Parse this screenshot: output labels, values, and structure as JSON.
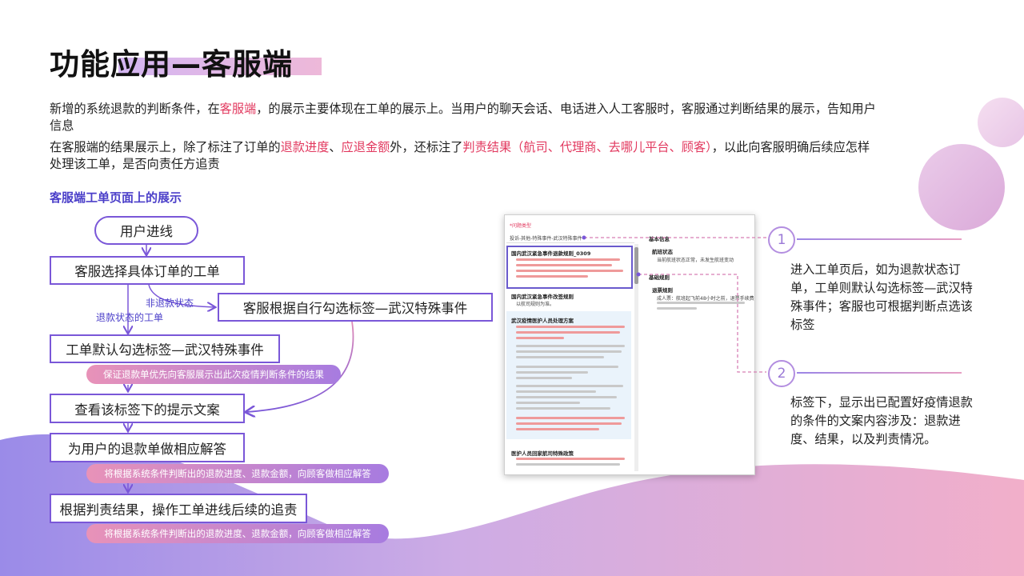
{
  "title": "功能应用—客服端",
  "intro": {
    "line1_a": "新增的系统退款的判断条件，在",
    "line1_hl": "客服端",
    "line1_b": "，的展示主要体现在工单的展示上。当用户的聊天会话、电话进入人工客服时，客服通过判断结果的展示，告知用户",
    "line1_c": "信息",
    "line2_a": "在客服端的结果展示上，除了标注了订单的",
    "line2_hl1": "退款进度",
    "line2_sep": "、",
    "line2_hl2": "应退金额",
    "line2_b": "外，还标注了",
    "line2_hl3": "判责结果（航司、代理商、去哪儿平台、顾客）",
    "line2_c": "，以此向客服明确后续应怎样",
    "line2_d": "处理该工单，是否向责任方追责"
  },
  "subtitle": "客服端工单页面上的展示",
  "flow": {
    "start": "用户进线",
    "step1": "客服选择具体订单的工单",
    "branch_label_refund": "退款状态的工单",
    "branch_label_nonrefund": "非退款状态",
    "manual": "客服根据自行勾选标签—武汉特殊事件",
    "step2": "工单默认勾选标签—武汉特殊事件",
    "tag2": "保证退款单优先向客服展示出此次疫情判断条件的结果",
    "step3": "查看该标签下的提示文案",
    "step4": "为用户的退款单做相应解答",
    "tag4": "将根据系统条件判断出的退款进度、退款金额，向顾客做相应解答",
    "step5": "根据判责结果，操作工单进线后续的追责",
    "tag5": "将根据系统条件判断出的退款进度、退款金额，向顾客做相应解答"
  },
  "screenshot": {
    "question_type": "*问题类型",
    "type_value": "投诉-其他-特殊事件-武汉特殊事件",
    "base_info": "基本信息",
    "item1_title": "国内武汉紧急事件退款规则_0309",
    "item2_title": "国内武汉紧急事件改签规则",
    "item2_sub": "以航司规则为准。",
    "item3_title": "武汉疫情医护人员处理方案",
    "item4_title": "医护人员回家航司特殊政策",
    "right1": "航班状态",
    "right1_sub": "当前航班状态正常，未发生航班变动",
    "right2": "基础规则",
    "right3": "退票规则",
    "right3_sub": "成人票：航班起飞前48小时之前，退票手续费为832..."
  },
  "notes": {
    "num1": "1",
    "num2": "2",
    "note1": "进入工单页后，如为退款状态订单，工单则默认勾选标签—武汉特殊事件；客服也可根据判断点选该标签",
    "note2": "标签下，显示出已配置好疫情退款的条件的文案内容涉及：退款进度、结果，以及判责情况。"
  },
  "colors": {
    "accent_purple": "#7a57d8",
    "accent_pink": "#e2395f",
    "tag_gradient_start": "#e892b8",
    "tag_gradient_end": "#a77be0"
  }
}
